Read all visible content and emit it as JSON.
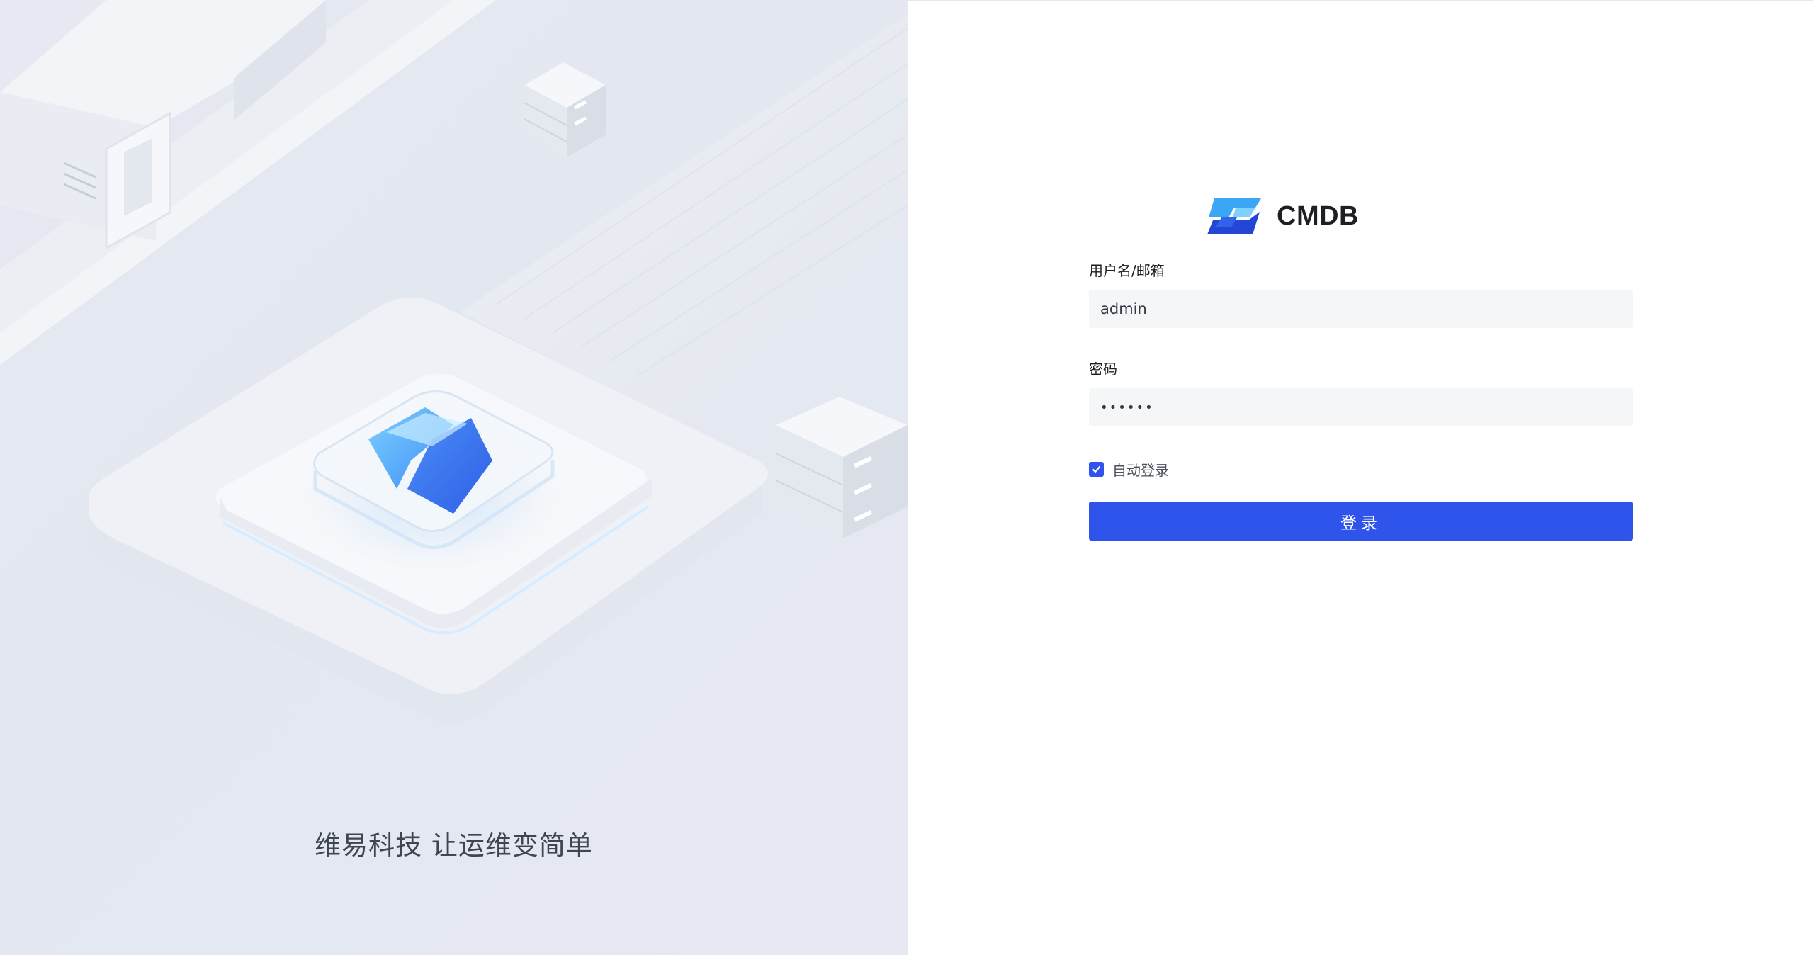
{
  "illustration": {
    "slogan": "维易科技 让运维变简单"
  },
  "brand": {
    "name": "CMDB",
    "logo_icon": "cmdb-logo-icon",
    "colors": {
      "primary": "#2f54eb",
      "light": "#3aa6f5"
    }
  },
  "login_form": {
    "username_label": "用户名/邮箱",
    "username_value": "admin",
    "password_label": "密码",
    "password_value": "••••••",
    "remember_label": "自动登录",
    "remember_checked": true,
    "submit_label": "登录"
  }
}
